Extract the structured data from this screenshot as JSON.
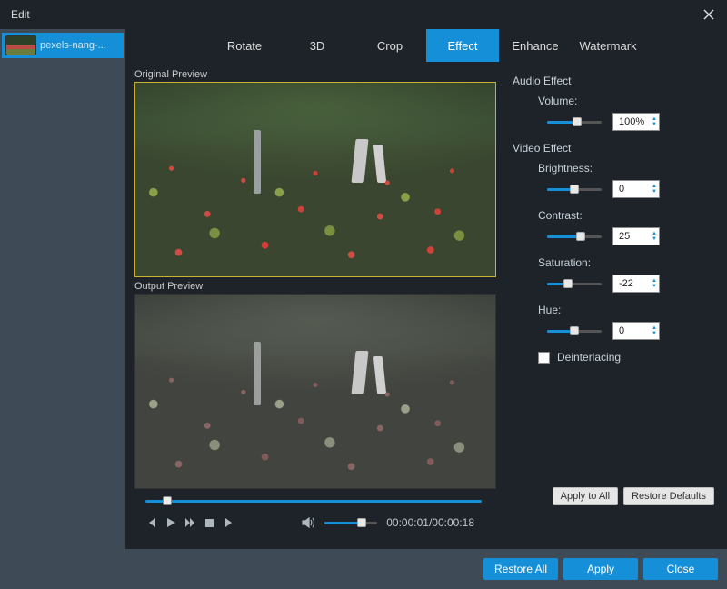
{
  "window": {
    "title": "Edit"
  },
  "sidebar": {
    "items": [
      {
        "filename": "pexels-nang-..."
      }
    ]
  },
  "tabs": [
    {
      "label": "Rotate",
      "active": false
    },
    {
      "label": "3D",
      "active": false
    },
    {
      "label": "Crop",
      "active": false
    },
    {
      "label": "Effect",
      "active": true
    },
    {
      "label": "Enhance",
      "active": false
    },
    {
      "label": "Watermark",
      "active": false
    }
  ],
  "preview": {
    "original_label": "Original Preview",
    "output_label": "Output Preview"
  },
  "panel": {
    "audio_section": "Audio Effect",
    "volume_label": "Volume:",
    "volume_value": "100%",
    "volume_pct": 55,
    "video_section": "Video Effect",
    "brightness_label": "Brightness:",
    "brightness_value": "0",
    "brightness_pct": 50,
    "contrast_label": "Contrast:",
    "contrast_value": "25",
    "contrast_pct": 62,
    "saturation_label": "Saturation:",
    "saturation_value": "-22",
    "saturation_pct": 38,
    "hue_label": "Hue:",
    "hue_value": "0",
    "hue_pct": 50,
    "deinterlacing_label": "Deinterlacing",
    "deinterlacing_checked": false
  },
  "playback": {
    "time_display": "00:00:01/00:00:18",
    "position_pct": 5,
    "volume_pct": 70
  },
  "buttons": {
    "apply_to_all": "Apply to All",
    "restore_defaults": "Restore Defaults",
    "restore_all": "Restore All",
    "apply": "Apply",
    "close": "Close"
  }
}
